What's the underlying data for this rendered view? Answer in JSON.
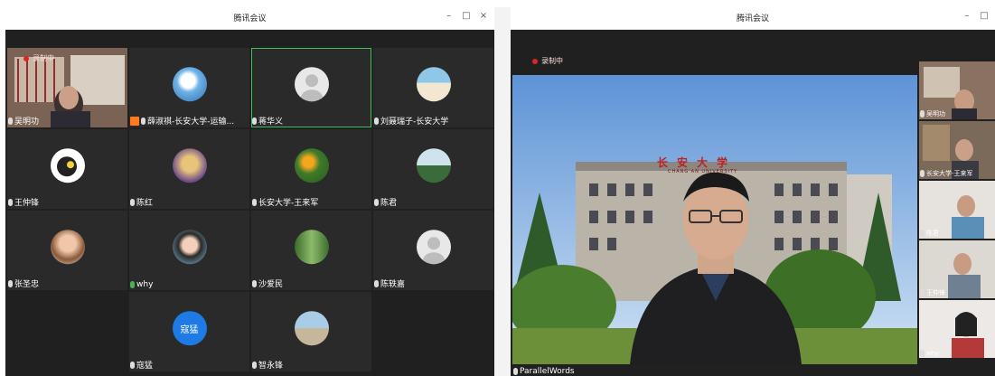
{
  "left_window": {
    "title": "腾讯会议",
    "controls": {
      "minimize": "–",
      "maximize": "□",
      "close": "×"
    },
    "recording": "录制中",
    "participants": [
      {
        "name": "吴明功",
        "video": true
      },
      {
        "name": "薛淑祺-长安大学-运输..."
      },
      {
        "name": "蒋华义"
      },
      {
        "name": "刘聂瑞子-长安大学"
      },
      {
        "name": "王仲锋"
      },
      {
        "name": "陈红"
      },
      {
        "name": "长安大学-王来军"
      },
      {
        "name": "陈君"
      },
      {
        "name": "张圣忠"
      },
      {
        "name": "why"
      },
      {
        "name": "沙爱民"
      },
      {
        "name": "陈轶嘉"
      },
      {
        "name": "寇猛",
        "avatar_text": "寇猛"
      },
      {
        "name": "智永锋"
      }
    ]
  },
  "right_window": {
    "title": "腾讯会议",
    "controls": {
      "minimize": "–",
      "maximize": "□"
    },
    "recording": "录制中",
    "building_sign": "长安大学",
    "building_sign_latin": "CHANG'AN UNIVERSITY",
    "speaker_label": "ParallelWords",
    "thumbnails": [
      {
        "name": "吴明功"
      },
      {
        "name": "长安大学-王来军"
      },
      {
        "name": "陈君"
      },
      {
        "name": "王仲锋"
      },
      {
        "name": "why"
      }
    ]
  }
}
